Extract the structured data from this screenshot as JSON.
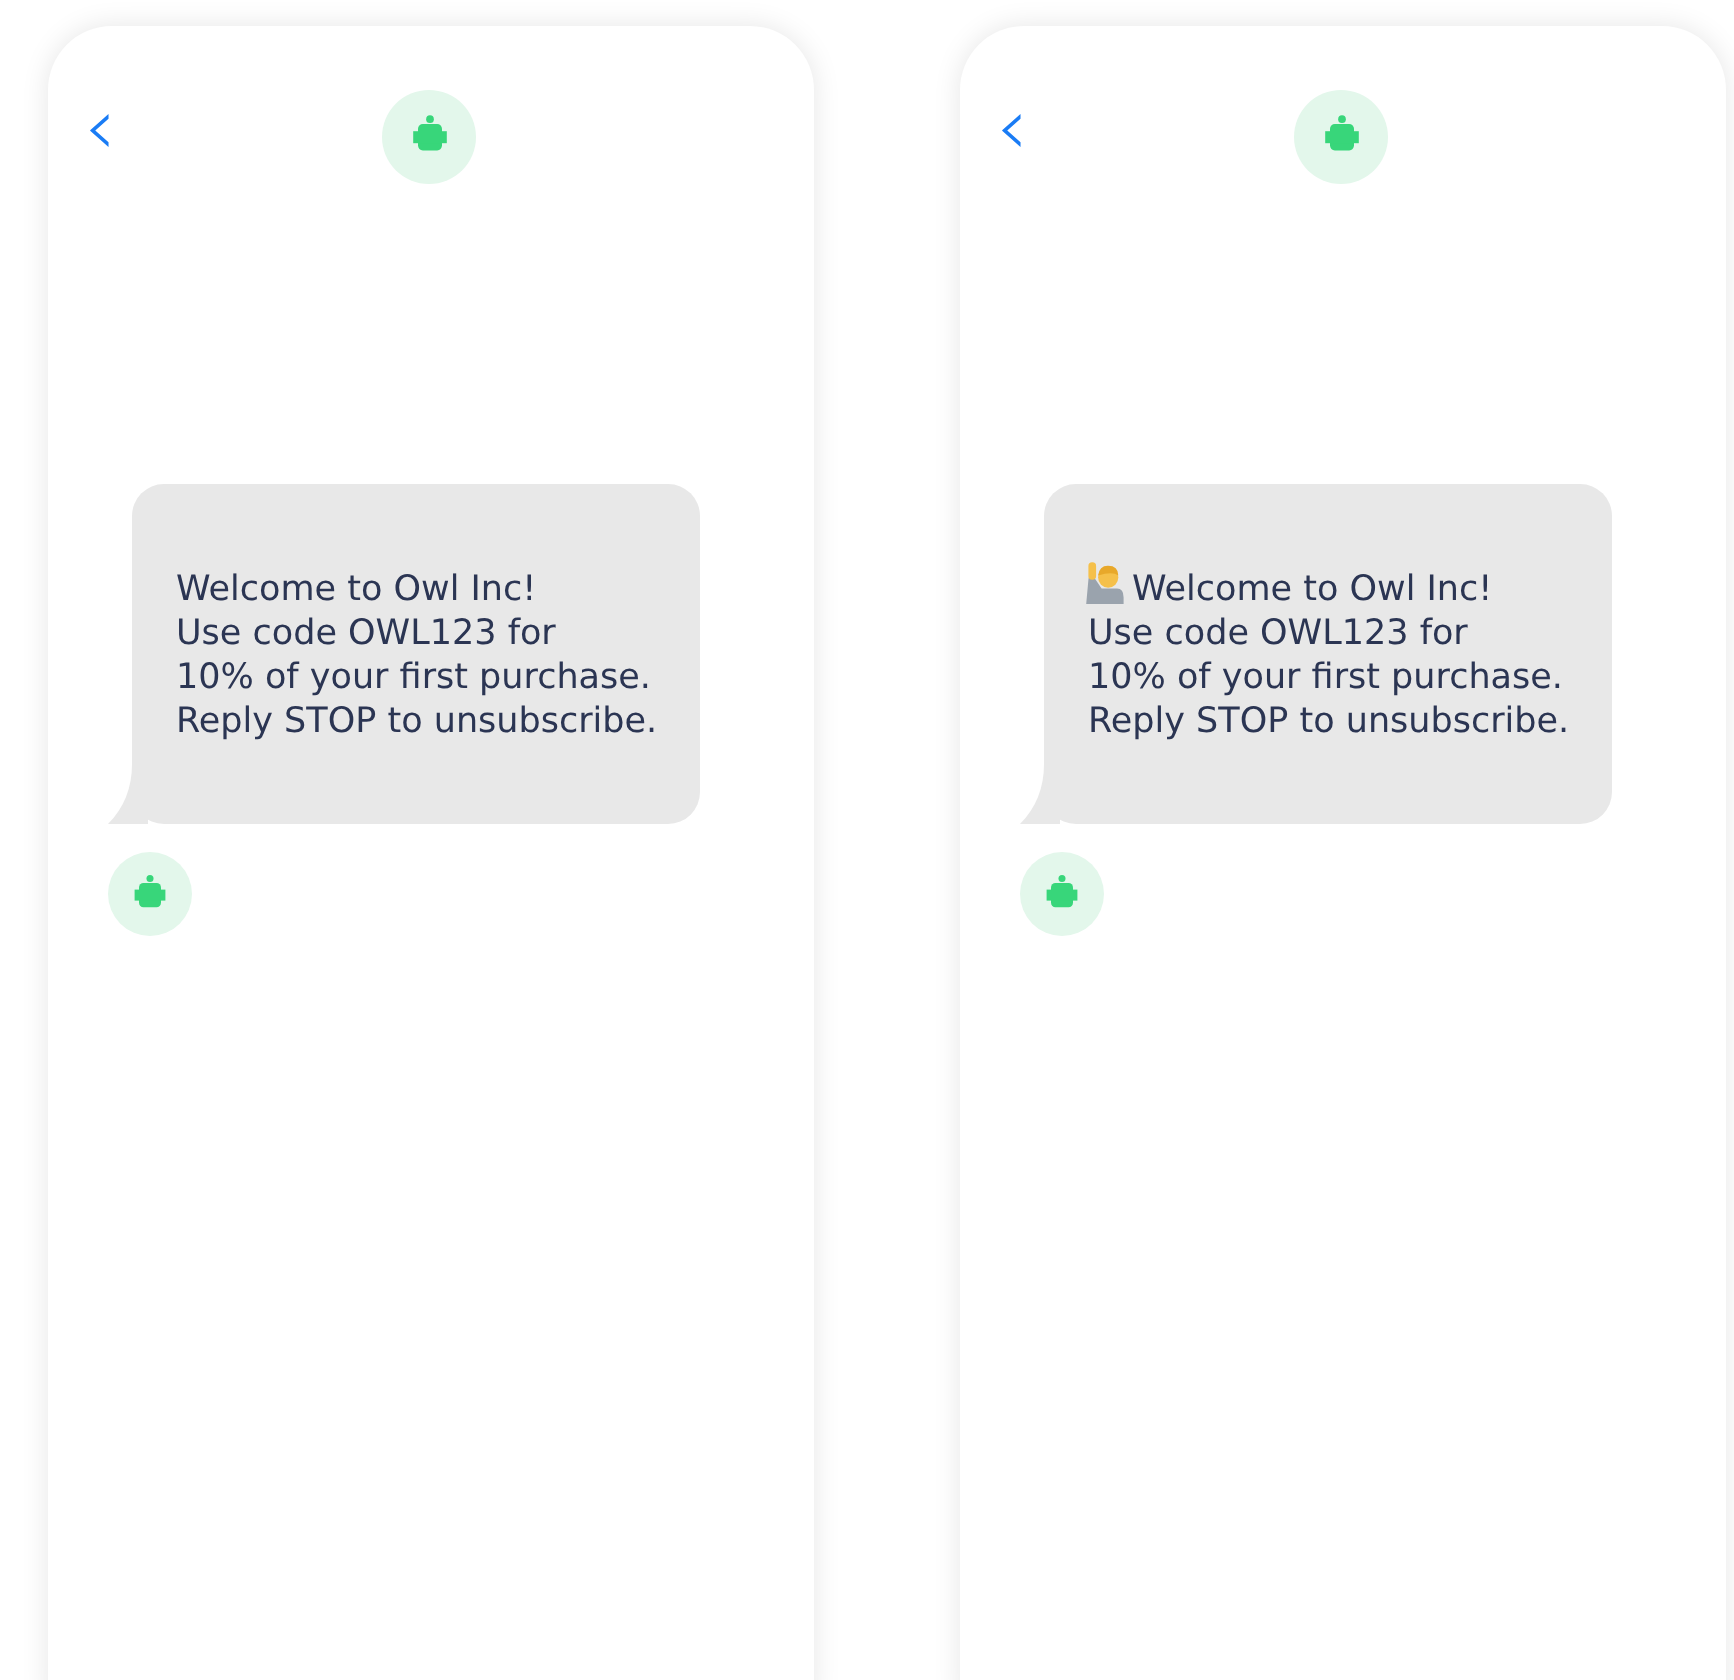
{
  "phones": [
    {
      "header": {
        "back": "‹"
      },
      "message": {
        "has_emoji": false,
        "lines": [
          "Welcome to Owl Inc!",
          "Use code OWL123 for",
          "10% of your first purchase.",
          "Reply STOP to unsubscribe."
        ]
      }
    },
    {
      "header": {
        "back": "‹"
      },
      "message": {
        "has_emoji": true,
        "lines": [
          "Welcome to Owl Inc!",
          "Use code OWL123 for",
          "10% of your first purchase.",
          "Reply STOP to unsubscribe."
        ]
      }
    }
  ]
}
